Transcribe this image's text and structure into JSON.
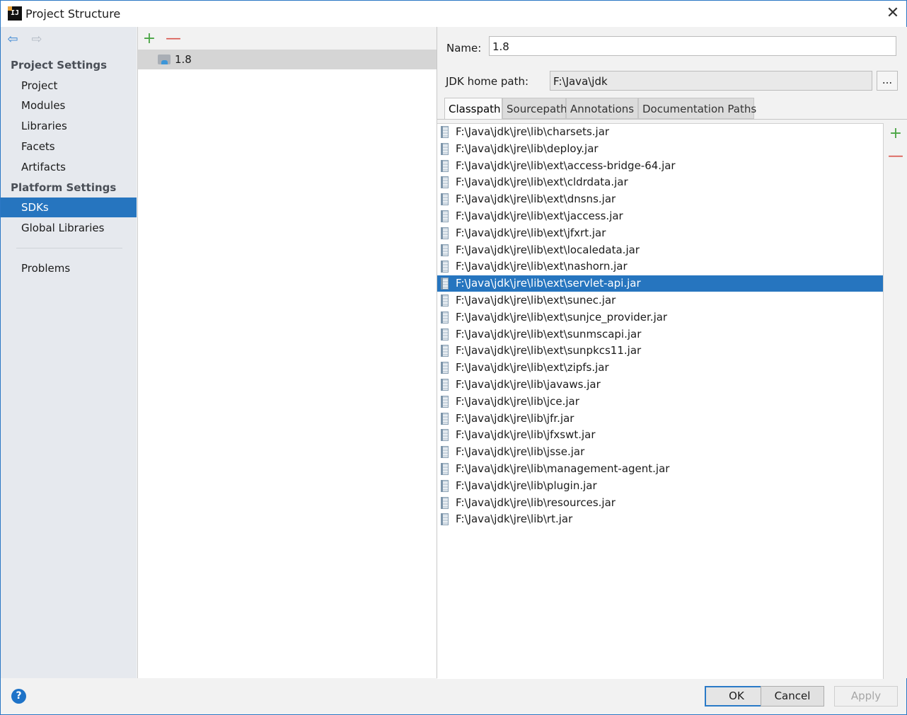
{
  "window": {
    "title": "Project Structure",
    "app_icon_text": "IJ",
    "close_glyph": "✕"
  },
  "nav": {
    "back_glyph": "⇦",
    "forward_glyph": "⇨",
    "project_settings_header": "Project Settings",
    "project_settings_items": [
      "Project",
      "Modules",
      "Libraries",
      "Facets",
      "Artifacts"
    ],
    "platform_settings_header": "Platform Settings",
    "platform_settings_items": [
      "SDKs",
      "Global Libraries"
    ],
    "selected_item": "SDKs",
    "problems": "Problems"
  },
  "sdk_list": {
    "add_glyph": "+",
    "remove_glyph": "—",
    "items": [
      "1.8"
    ]
  },
  "sdk_detail": {
    "name_label": "Name:",
    "name_value": "1.8",
    "jdk_home_label": "JDK home path:",
    "jdk_home_value": "F:\\Java\\jdk",
    "browse_label": "...",
    "tabs": [
      "Classpath",
      "Sourcepath",
      "Annotations",
      "Documentation Paths"
    ],
    "active_tab": "Classpath",
    "classpath_add_glyph": "+",
    "classpath_remove_glyph": "—",
    "selected_path": "F:\\Java\\jdk\\jre\\lib\\ext\\servlet-api.jar",
    "classpath": [
      "F:\\Java\\jdk\\jre\\lib\\charsets.jar",
      "F:\\Java\\jdk\\jre\\lib\\deploy.jar",
      "F:\\Java\\jdk\\jre\\lib\\ext\\access-bridge-64.jar",
      "F:\\Java\\jdk\\jre\\lib\\ext\\cldrdata.jar",
      "F:\\Java\\jdk\\jre\\lib\\ext\\dnsns.jar",
      "F:\\Java\\jdk\\jre\\lib\\ext\\jaccess.jar",
      "F:\\Java\\jdk\\jre\\lib\\ext\\jfxrt.jar",
      "F:\\Java\\jdk\\jre\\lib\\ext\\localedata.jar",
      "F:\\Java\\jdk\\jre\\lib\\ext\\nashorn.jar",
      "F:\\Java\\jdk\\jre\\lib\\ext\\servlet-api.jar",
      "F:\\Java\\jdk\\jre\\lib\\ext\\sunec.jar",
      "F:\\Java\\jdk\\jre\\lib\\ext\\sunjce_provider.jar",
      "F:\\Java\\jdk\\jre\\lib\\ext\\sunmscapi.jar",
      "F:\\Java\\jdk\\jre\\lib\\ext\\sunpkcs11.jar",
      "F:\\Java\\jdk\\jre\\lib\\ext\\zipfs.jar",
      "F:\\Java\\jdk\\jre\\lib\\javaws.jar",
      "F:\\Java\\jdk\\jre\\lib\\jce.jar",
      "F:\\Java\\jdk\\jre\\lib\\jfr.jar",
      "F:\\Java\\jdk\\jre\\lib\\jfxswt.jar",
      "F:\\Java\\jdk\\jre\\lib\\jsse.jar",
      "F:\\Java\\jdk\\jre\\lib\\management-agent.jar",
      "F:\\Java\\jdk\\jre\\lib\\plugin.jar",
      "F:\\Java\\jdk\\jre\\lib\\resources.jar",
      "F:\\Java\\jdk\\jre\\lib\\rt.jar"
    ]
  },
  "footer": {
    "help_glyph": "?",
    "ok_label": "OK",
    "cancel_label": "Cancel",
    "apply_label": "Apply"
  }
}
